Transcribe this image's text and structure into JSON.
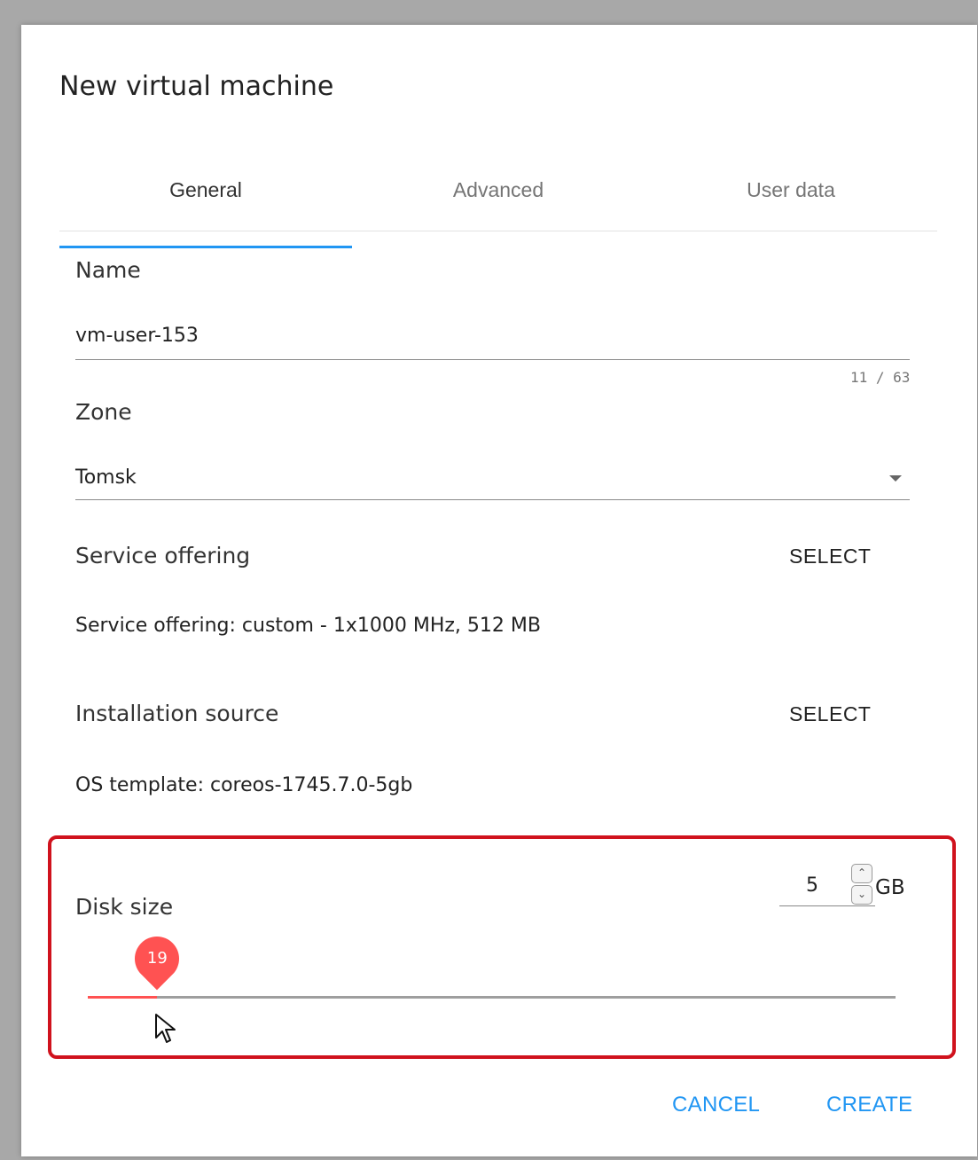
{
  "dialog": {
    "title": "New virtual machine",
    "tabs": [
      {
        "label": "General",
        "active": true
      },
      {
        "label": "Advanced",
        "active": false
      },
      {
        "label": "User data",
        "active": false
      }
    ]
  },
  "form": {
    "name": {
      "label": "Name",
      "value": "vm-user-153",
      "counter": "11 / 63"
    },
    "zone": {
      "label": "Zone",
      "value": "Tomsk"
    },
    "service_offering": {
      "label": "Service offering",
      "select_label": "SELECT",
      "summary": "Service offering: custom - 1x1000 MHz, 512 MB"
    },
    "installation_source": {
      "label": "Installation source",
      "select_label": "SELECT",
      "summary": "OS template: coreos-1745.7.0-5gb"
    },
    "disk_size": {
      "label": "Disk size",
      "input_value": "5",
      "unit": "GB",
      "slider_value": "19",
      "slider_fraction": 0.086
    }
  },
  "actions": {
    "cancel_label": "CANCEL",
    "create_label": "CREATE"
  },
  "colors": {
    "accent": "#2196f3",
    "slider": "#ff5252",
    "highlight": "#d0121d"
  }
}
